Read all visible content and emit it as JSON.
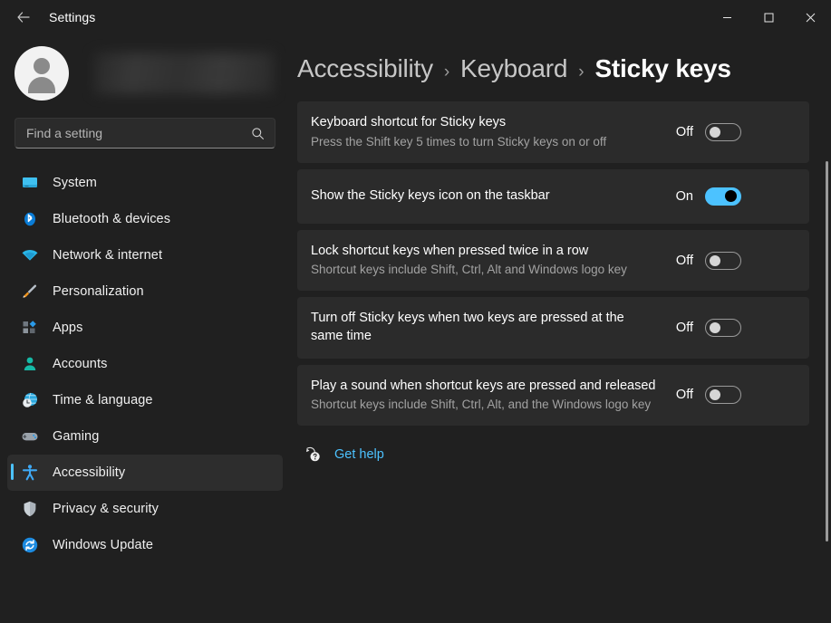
{
  "titlebar": {
    "back_label": "back-arrow",
    "app_title": "Settings",
    "minimize": "minimize",
    "maximize": "maximize",
    "close": "close"
  },
  "sidebar": {
    "profile": {
      "name": ""
    },
    "search": {
      "placeholder": "Find a setting",
      "value": ""
    },
    "items": [
      {
        "label": "System",
        "icon": "monitor-icon",
        "active": false
      },
      {
        "label": "Bluetooth & devices",
        "icon": "bluetooth-icon",
        "active": false
      },
      {
        "label": "Network & internet",
        "icon": "wifi-icon",
        "active": false
      },
      {
        "label": "Personalization",
        "icon": "paintbrush-icon",
        "active": false
      },
      {
        "label": "Apps",
        "icon": "apps-icon",
        "active": false
      },
      {
        "label": "Accounts",
        "icon": "person-icon",
        "active": false
      },
      {
        "label": "Time & language",
        "icon": "clock-globe-icon",
        "active": false
      },
      {
        "label": "Gaming",
        "icon": "gamepad-icon",
        "active": false
      },
      {
        "label": "Accessibility",
        "icon": "accessibility-person-icon",
        "active": true
      },
      {
        "label": "Privacy & security",
        "icon": "shield-icon",
        "active": false
      },
      {
        "label": "Windows Update",
        "icon": "update-refresh-icon",
        "active": false
      }
    ]
  },
  "main": {
    "breadcrumb": [
      {
        "label": "Accessibility",
        "current": false
      },
      {
        "label": "Keyboard",
        "current": false
      },
      {
        "label": "Sticky keys",
        "current": true
      }
    ],
    "breadcrumb_separator": "›",
    "settings": [
      {
        "title": "Keyboard shortcut for Sticky keys",
        "desc": "Press the Shift key 5 times to turn Sticky keys on or off",
        "state_label": "Off",
        "state_on": false
      },
      {
        "title": "Show the Sticky keys icon on the taskbar",
        "desc": "",
        "state_label": "On",
        "state_on": true
      },
      {
        "title": "Lock shortcut keys when pressed twice in a row",
        "desc": "Shortcut keys include Shift, Ctrl, Alt and Windows logo key",
        "state_label": "Off",
        "state_on": false
      },
      {
        "title": "Turn off Sticky keys when two keys are pressed at the same time",
        "desc": "",
        "state_label": "Off",
        "state_on": false
      },
      {
        "title": "Play a sound when shortcut keys are pressed and released",
        "desc": "Shortcut keys include Shift, Ctrl, Alt, and the Windows logo key",
        "state_label": "Off",
        "state_on": false
      }
    ],
    "get_help": {
      "label": "Get help",
      "icon": "help-question-icon"
    }
  },
  "colors": {
    "accent": "#4cc2ff",
    "page_bg": "#202020",
    "card_bg": "#2b2b2b",
    "text_primary": "#ffffff",
    "text_secondary": "#a2a2a2"
  }
}
